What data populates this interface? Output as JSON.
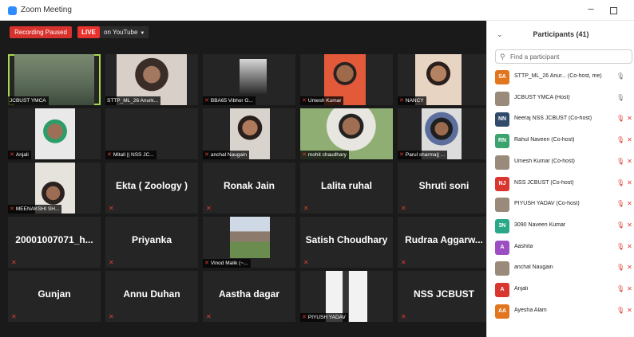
{
  "window": {
    "title": "Zoom Meeting",
    "minimize": "–"
  },
  "controls": {
    "recording": "Recording Paused",
    "live": "LIVE",
    "youtube": "on YouTube",
    "youtube_caret": "▼"
  },
  "tiles": {
    "t1": {
      "label": "JCBUST YMCA"
    },
    "t2": {
      "label": "STTP_ML_26 Anurk..."
    },
    "t3": {
      "label": "BBA65 Vibhor G..."
    },
    "t4": {
      "label": "Umesh Kumar"
    },
    "t5": {
      "label": "NANCY"
    },
    "t6": {
      "label": "Anjali"
    },
    "t7": {
      "label": "Mitali || NSS JC..."
    },
    "t8": {
      "label": "anchal Naugain"
    },
    "t9": {
      "label": "mohit chaudhary"
    },
    "t10": {
      "label": "Parul sharma|| ..."
    },
    "t11": {
      "label": "MEENAKSHI SH..."
    },
    "t12": {
      "name": "Ekta ( Zoology )"
    },
    "t13": {
      "name": "Ronak Jain"
    },
    "t14": {
      "name": "Lalita ruhal"
    },
    "t15": {
      "name": "Shruti soni"
    },
    "t16": {
      "name": "20001007071_h..."
    },
    "t17": {
      "name": "Priyanka"
    },
    "t18": {
      "label": "Vinod Malik (~..."
    },
    "t19": {
      "name": "Satish Choudhary"
    },
    "t20": {
      "name": "Rudraa Aggarw..."
    },
    "t21": {
      "name": "Gunjan"
    },
    "t22": {
      "name": "Annu Duhan"
    },
    "t23": {
      "name": "Aastha dagar"
    },
    "t24": {
      "label": "PIYUSH YADAV"
    },
    "t25": {
      "name": "NSS JCBUST"
    }
  },
  "panel": {
    "title": "Participants (41)",
    "search_placeholder": "Find a participant",
    "participants": [
      {
        "initials": "SA",
        "color": "#e1761f",
        "name": "STTP_ML_26 Anur... (Co-host, me)",
        "mic": "🎙",
        "cam": ""
      },
      {
        "initials": "",
        "color": "#9a8a7a",
        "name": "JCBUST YMCA (Host)",
        "mic": "🎙",
        "cam": ""
      },
      {
        "initials": "NN",
        "color": "#2f4a6a",
        "name": "Neeraj NSS JCBUST (Co-host)",
        "mic": "🎙",
        "cam": "✕"
      },
      {
        "initials": "RN",
        "color": "#3aa36e",
        "name": "Rahul Naveen (Co-host)",
        "mic": "🎙",
        "cam": "✕"
      },
      {
        "initials": "",
        "color": "#9a8a7a",
        "name": "Umesh Kumar (Co-host)",
        "mic": "🎙",
        "cam": "✕"
      },
      {
        "initials": "NJ",
        "color": "#d9362f",
        "name": "NSS JCBUST (Co-host)",
        "mic": "🎙",
        "cam": "✕"
      },
      {
        "initials": "",
        "color": "#9a8a7a",
        "name": "PIYUSH YADAV (Co-host)",
        "mic": "🎙",
        "cam": "✕"
      },
      {
        "initials": "3N",
        "color": "#2aa889",
        "name": "3090 Naveen Kumar",
        "mic": "🎙",
        "cam": "✕"
      },
      {
        "initials": "A",
        "color": "#9b4fc3",
        "name": "Aashita",
        "mic": "🎙",
        "cam": "✕"
      },
      {
        "initials": "",
        "color": "#9a8a7a",
        "name": "anchal Naugain",
        "mic": "🎙",
        "cam": "✕"
      },
      {
        "initials": "A",
        "color": "#d9362f",
        "name": "Anjali",
        "mic": "🎙",
        "cam": "✕"
      },
      {
        "initials": "AA",
        "color": "#e1761f",
        "name": "Ayesha Alam",
        "mic": "🎙",
        "cam": "✕"
      }
    ]
  }
}
